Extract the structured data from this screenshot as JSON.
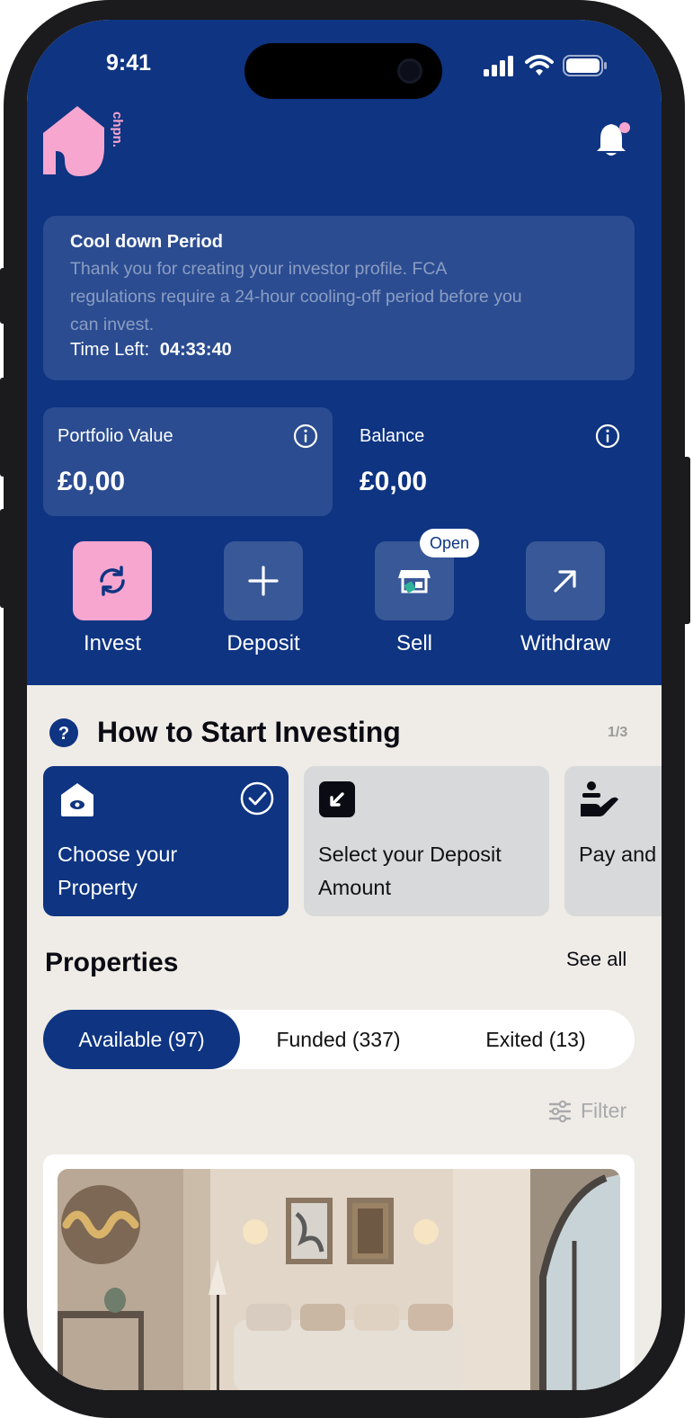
{
  "status_bar": {
    "time": "9:41"
  },
  "brand": {
    "logo_text": "chpn."
  },
  "colors": {
    "primary": "#0e3482",
    "accent_pink": "#f6a6cf",
    "background": "#efece7"
  },
  "cooldown": {
    "title": "Cool down Period",
    "message_lines": [
      "Thank you for creating your investor profile. FCA",
      "regulations require a 24-hour cooling-off period before you",
      "can invest."
    ],
    "time_left_label": "Time Left:",
    "time_left_value": "04:33:40"
  },
  "portfolio": {
    "label": "Portfolio Value",
    "value": "£0,00"
  },
  "balance": {
    "label": "Balance",
    "value": "£0,00"
  },
  "actions": [
    {
      "label": "Invest",
      "icon": "refresh-icon"
    },
    {
      "label": "Deposit",
      "icon": "plus-icon"
    },
    {
      "label": "Sell",
      "icon": "shop-icon",
      "badge": "Open"
    },
    {
      "label": "Withdraw",
      "icon": "arrow-up-right-icon"
    }
  ],
  "how_to_start": {
    "title": "How to Start Investing",
    "page_indicator": "1/3",
    "steps": [
      {
        "label_lines": [
          "Choose your",
          "Property"
        ],
        "icon": "house-eye-icon",
        "completed": true
      },
      {
        "label_lines": [
          "Select your Deposit",
          "Amount"
        ],
        "icon": "arrow-square-icon",
        "completed": false
      },
      {
        "label_lines": [
          "Pay and"
        ],
        "icon": "hand-coin-icon",
        "completed": false
      }
    ]
  },
  "properties": {
    "title": "Properties",
    "see_all": "See all",
    "tabs": [
      {
        "label": "Available (97)",
        "active": true
      },
      {
        "label": "Funded (337)",
        "active": false
      },
      {
        "label": "Exited (13)",
        "active": false
      }
    ],
    "filter_label": "Filter"
  }
}
